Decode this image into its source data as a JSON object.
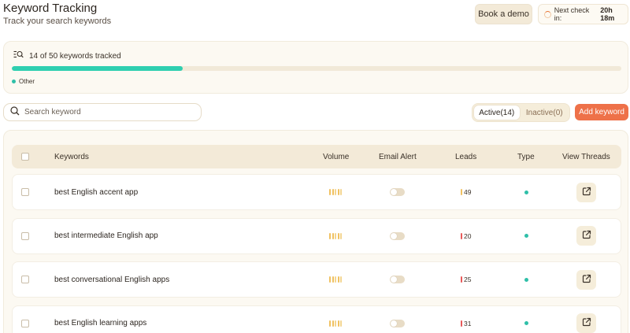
{
  "header": {
    "title": "Keyword Tracking",
    "subtitle": "Track your search keywords",
    "book_demo_label": "Book a demo",
    "next_check_label": "Next check in:",
    "next_check_value": "20h 18m"
  },
  "usage": {
    "summary": "14 of 50 keywords tracked",
    "tracked": 14,
    "limit": 50,
    "progress_fraction": 0.28,
    "progress_color": "#2fcfb0",
    "legend_label": "Other"
  },
  "search": {
    "placeholder": "Search keyword",
    "value": ""
  },
  "filters": {
    "active_label": "Active(14)",
    "inactive_label": "Inactive(0)",
    "selected": "active"
  },
  "add_keyword_label": "Add keyword",
  "accent_color": "#ee7149",
  "table": {
    "columns": {
      "keywords": "Keywords",
      "volume": "Volume",
      "email_alert": "Email Alert",
      "leads": "Leads",
      "type": "Type",
      "view_threads": "View Threads"
    },
    "rows": [
      {
        "keyword": "best English accent app",
        "leads": "49",
        "lead_color": "#f0c160",
        "email_alert": false
      },
      {
        "keyword": "best intermediate English app",
        "leads": "20",
        "lead_color": "#e85a5a",
        "email_alert": false
      },
      {
        "keyword": "best conversational English apps",
        "leads": "25",
        "lead_color": "#e85a5a",
        "email_alert": false
      },
      {
        "keyword": "best English learning apps",
        "leads": "31",
        "lead_color": "#e85a5a",
        "email_alert": false
      }
    ]
  },
  "icons": {
    "spinner": "loading-spinner-icon",
    "usage": "list-search-icon",
    "search": "search-icon",
    "external": "external-link-icon"
  }
}
